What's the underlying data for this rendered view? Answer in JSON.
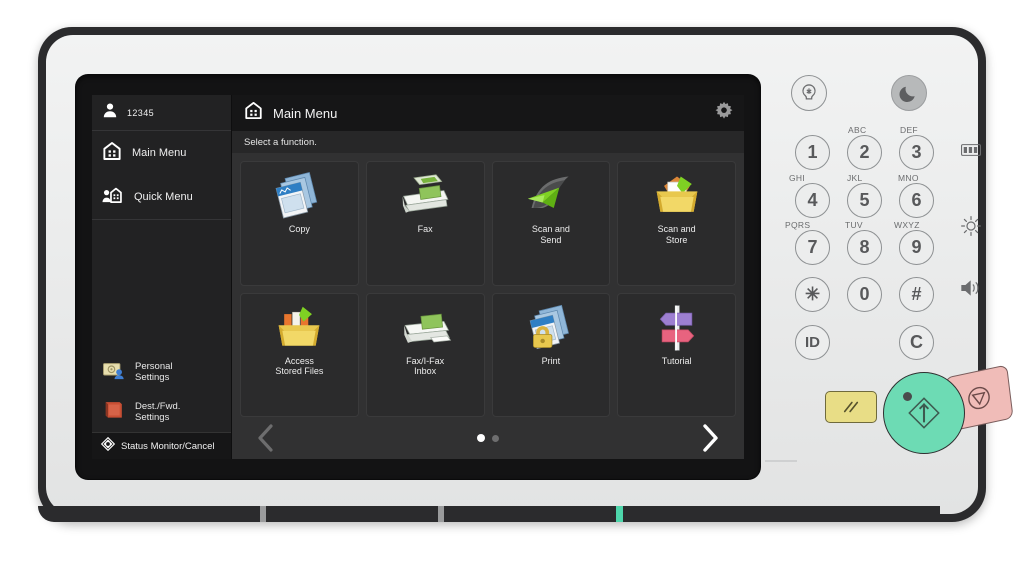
{
  "device": {
    "name": "multifunction-printer-control-panel",
    "frame_color": "#2b2b2d",
    "body_color": "#eceded",
    "led_color": "#4ed6ab"
  },
  "lcd": {
    "sidebar": {
      "user": {
        "icon": "user-icon",
        "id": "12345"
      },
      "items": [
        {
          "icon": "home-icon",
          "label": "Main Menu"
        },
        {
          "icon": "quick-menu-icon",
          "label": "Quick Menu"
        }
      ],
      "secondary": [
        {
          "icon": "personal-settings-icon",
          "label": "Personal\nSettings",
          "line1": "Personal",
          "line2": "Settings"
        },
        {
          "icon": "dest-fwd-settings-icon",
          "label": "Dest./Fwd.\nSettings",
          "line1": "Dest./Fwd.",
          "line2": "Settings"
        }
      ],
      "status": {
        "icon": "status-monitor-icon",
        "label": "Status Monitor/Cancel"
      }
    },
    "header": {
      "icon": "home-icon",
      "title": "Main Menu",
      "settings_icon": "gear-icon"
    },
    "instruction": "Select a function.",
    "functions": [
      {
        "icon": "copy-icon",
        "line1": "Copy",
        "line2": ""
      },
      {
        "icon": "fax-icon",
        "line1": "Fax",
        "line2": ""
      },
      {
        "icon": "scan-send-icon",
        "line1": "Scan and",
        "line2": "Send"
      },
      {
        "icon": "scan-store-icon",
        "line1": "Scan and",
        "line2": "Store"
      },
      {
        "icon": "stored-files-icon",
        "line1": "Access",
        "line2": "Stored Files"
      },
      {
        "icon": "fax-inbox-icon",
        "line1": "Fax/I-Fax",
        "line2": "Inbox"
      },
      {
        "icon": "print-icon",
        "line1": "Print",
        "line2": ""
      },
      {
        "icon": "tutorial-icon",
        "line1": "Tutorial",
        "line2": ""
      }
    ],
    "pager": {
      "prev_icon": "chevron-left-icon",
      "next_icon": "chevron-right-icon",
      "pages": 2,
      "current_page": 1
    }
  },
  "keypad": {
    "top_keys": [
      {
        "name": "energy-saver-key",
        "glyph": "✻"
      },
      {
        "name": "sleep-key",
        "glyph": "☾"
      }
    ],
    "numeric": [
      {
        "digit": "1",
        "letters": ""
      },
      {
        "digit": "2",
        "letters": "ABC"
      },
      {
        "digit": "3",
        "letters": "DEF"
      },
      {
        "digit": "4",
        "letters": "GHI"
      },
      {
        "digit": "5",
        "letters": "JKL"
      },
      {
        "digit": "6",
        "letters": "MNO"
      },
      {
        "digit": "7",
        "letters": "PQRS"
      },
      {
        "digit": "8",
        "letters": "TUV"
      },
      {
        "digit": "9",
        "letters": "WXYZ"
      }
    ],
    "bottom_row": [
      {
        "name": "asterisk-key",
        "glyph": "✳"
      },
      {
        "name": "zero-key",
        "glyph": "0"
      },
      {
        "name": "hash-key",
        "glyph": "#"
      }
    ],
    "function_row": [
      {
        "name": "id-key",
        "glyph": "ID"
      },
      {
        "name": "clear-key",
        "glyph": "C"
      }
    ],
    "side_icons": [
      {
        "name": "counter-check-icon",
        "glyph": "⛁"
      },
      {
        "name": "brightness-icon",
        "glyph": "☀"
      },
      {
        "name": "volume-icon",
        "glyph": "🔊"
      }
    ],
    "action_keys": [
      {
        "name": "reset-button",
        "glyph": "//",
        "color": "#e8dd86"
      },
      {
        "name": "start-button",
        "glyph": "◇",
        "color": "#6ddbb4"
      },
      {
        "name": "stop-button",
        "glyph": "▽",
        "color": "#f0bcb8"
      }
    ]
  }
}
